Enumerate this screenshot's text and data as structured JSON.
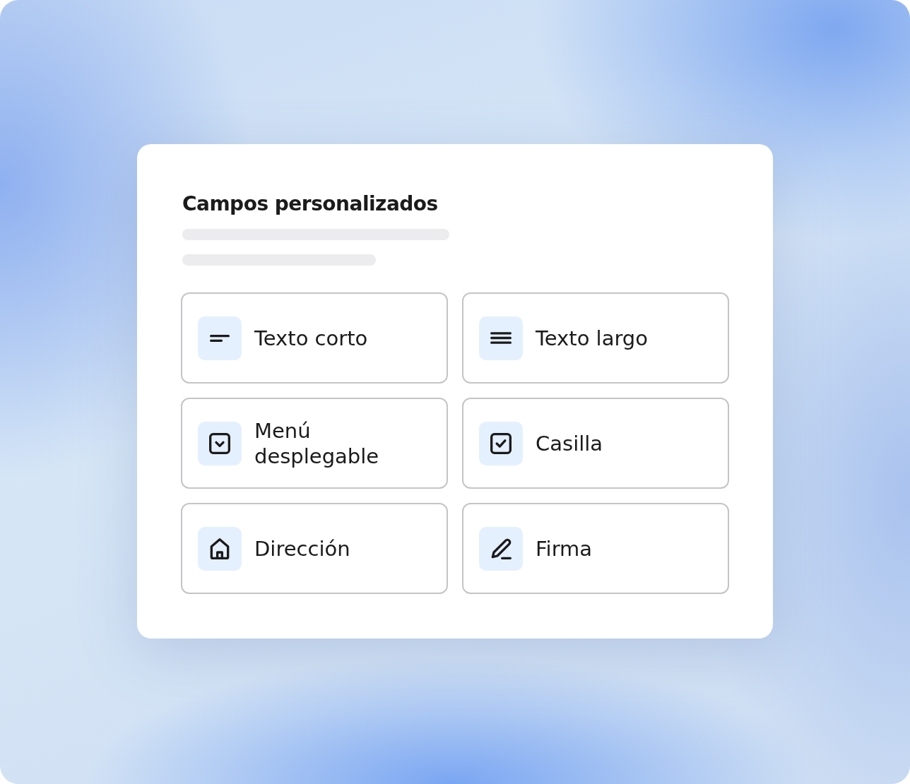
{
  "card": {
    "title": "Campos personalizados",
    "fields": [
      {
        "kind": "short-text",
        "label": "Texto corto"
      },
      {
        "kind": "long-text",
        "label": "Texto largo"
      },
      {
        "kind": "dropdown",
        "label": "Menú desplegable"
      },
      {
        "kind": "checkbox",
        "label": "Casilla"
      },
      {
        "kind": "address",
        "label": "Dirección"
      },
      {
        "kind": "signature",
        "label": "Firma"
      }
    ]
  }
}
